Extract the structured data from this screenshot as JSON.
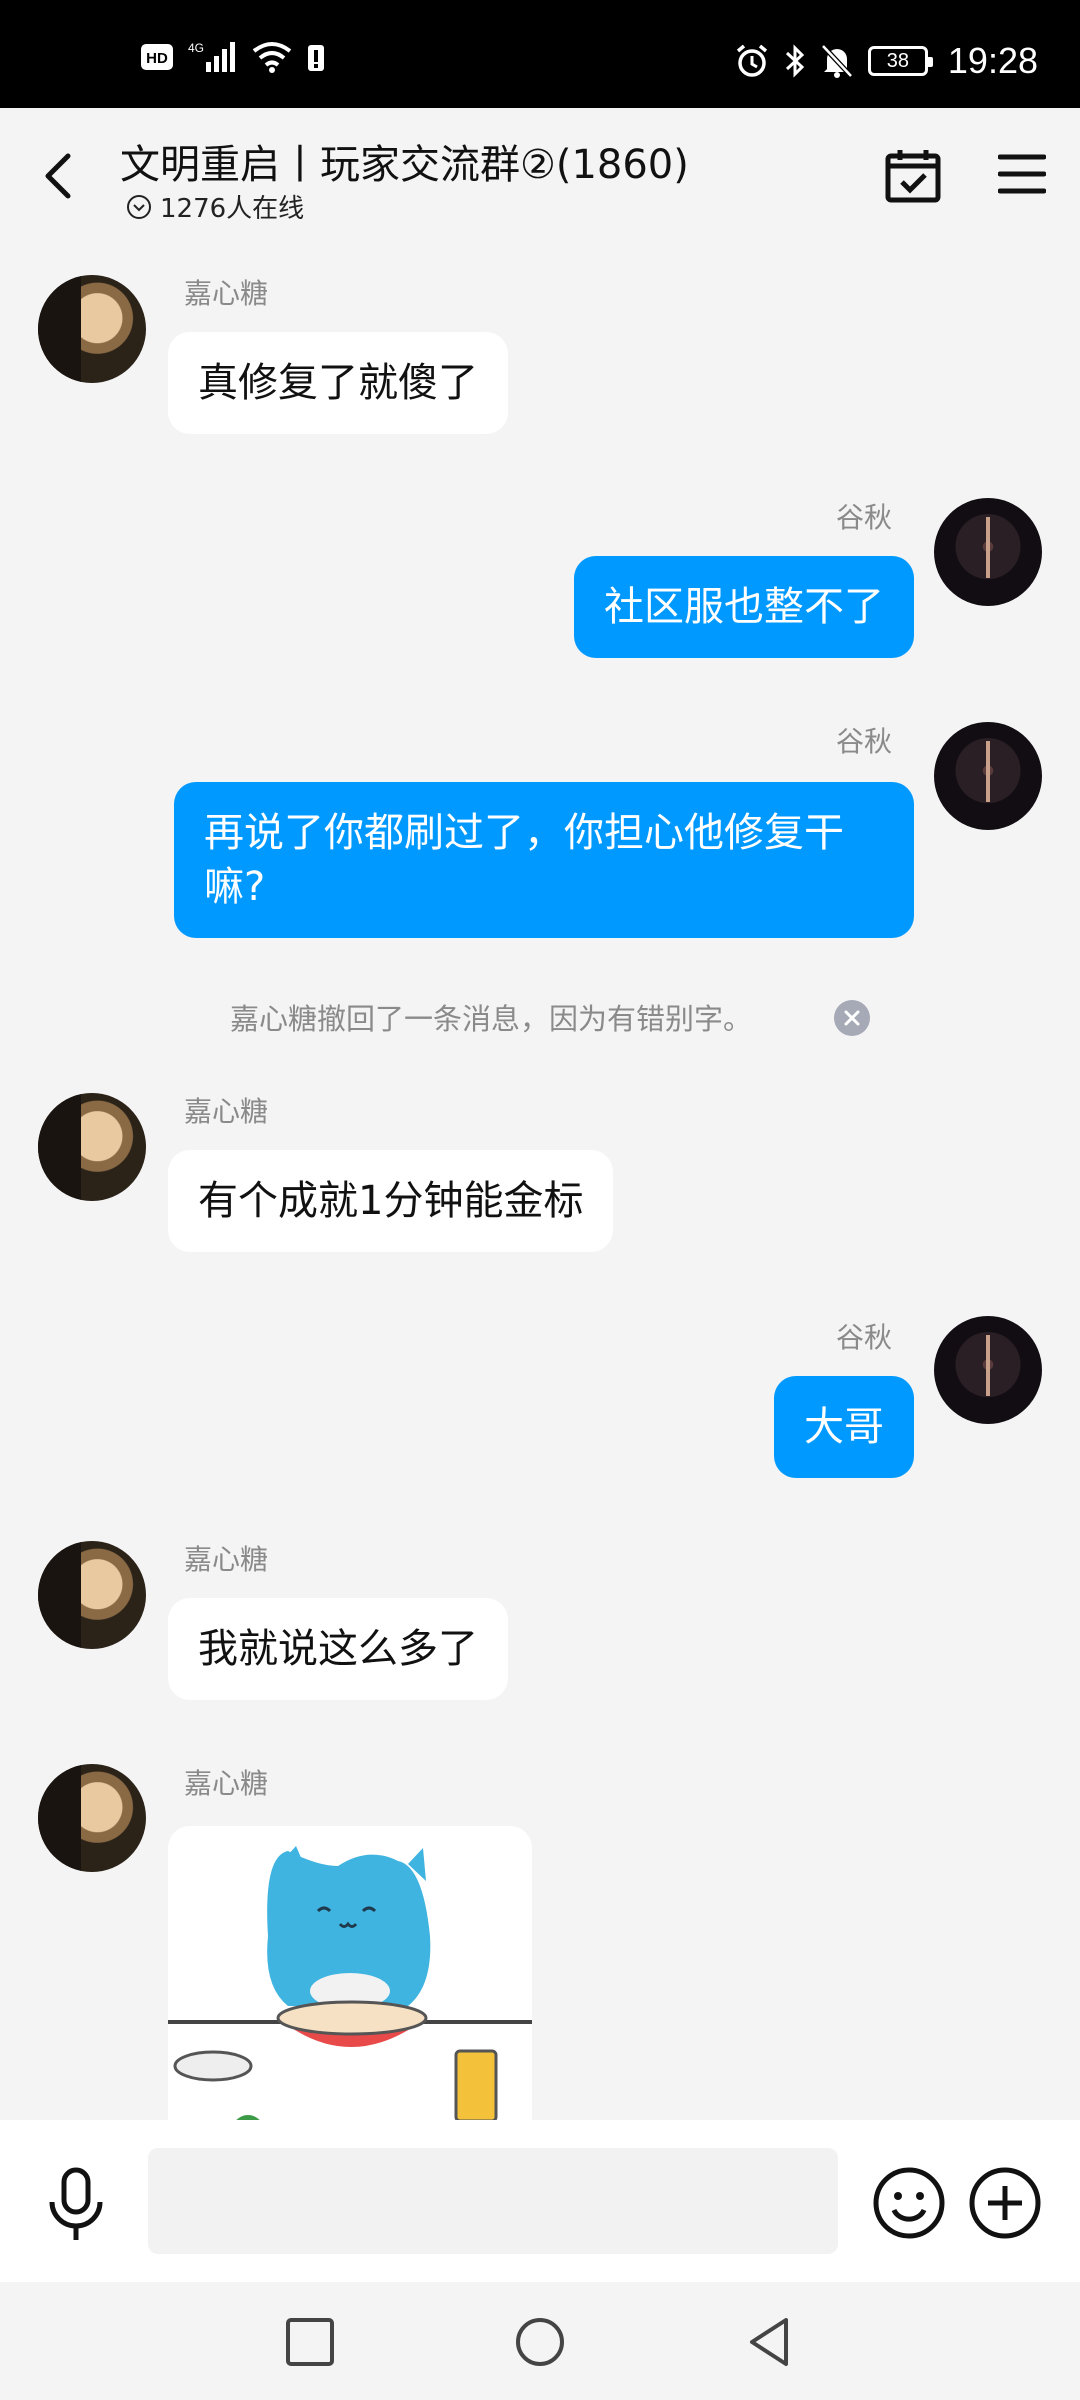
{
  "status_bar": {
    "hd_label": "HD",
    "network_label": "4G",
    "battery_level": "38",
    "time": "19:28"
  },
  "header": {
    "title": "文明重启丨玩家交流群②(1860)",
    "online_count": "1276人在线"
  },
  "messages": [
    {
      "sender": "嘉心糖",
      "text": "真修复了就傻了",
      "direction": "in"
    },
    {
      "sender": "谷秋",
      "text": "社区服也整不了",
      "direction": "out"
    },
    {
      "sender": "谷秋",
      "text": "再说了你都刷过了，你担心他修复干嘛?",
      "direction": "out"
    },
    {
      "sender": "嘉心糖",
      "text": "有个成就1分钟能金标",
      "direction": "in"
    },
    {
      "sender": "谷秋",
      "text": "大哥",
      "direction": "out"
    },
    {
      "sender": "嘉心糖",
      "text": "我就说这么多了",
      "direction": "in"
    },
    {
      "sender": "嘉心糖",
      "text": "",
      "direction": "in",
      "type": "sticker"
    }
  ],
  "system_notice": "嘉心糖撤回了一条消息，因为有错别字。",
  "input": {
    "placeholder": ""
  },
  "colors": {
    "accent": "#0099ff",
    "background": "#f4f4f5",
    "bubble_in": "#ffffff"
  },
  "icons": {
    "back": "chevron-left-icon",
    "calendar": "calendar-check-icon",
    "menu": "hamburger-menu-icon",
    "mic": "microphone-icon",
    "emoji": "smiley-icon",
    "plus": "plus-circle-icon",
    "scroll_down": "chevron-down-icon"
  }
}
